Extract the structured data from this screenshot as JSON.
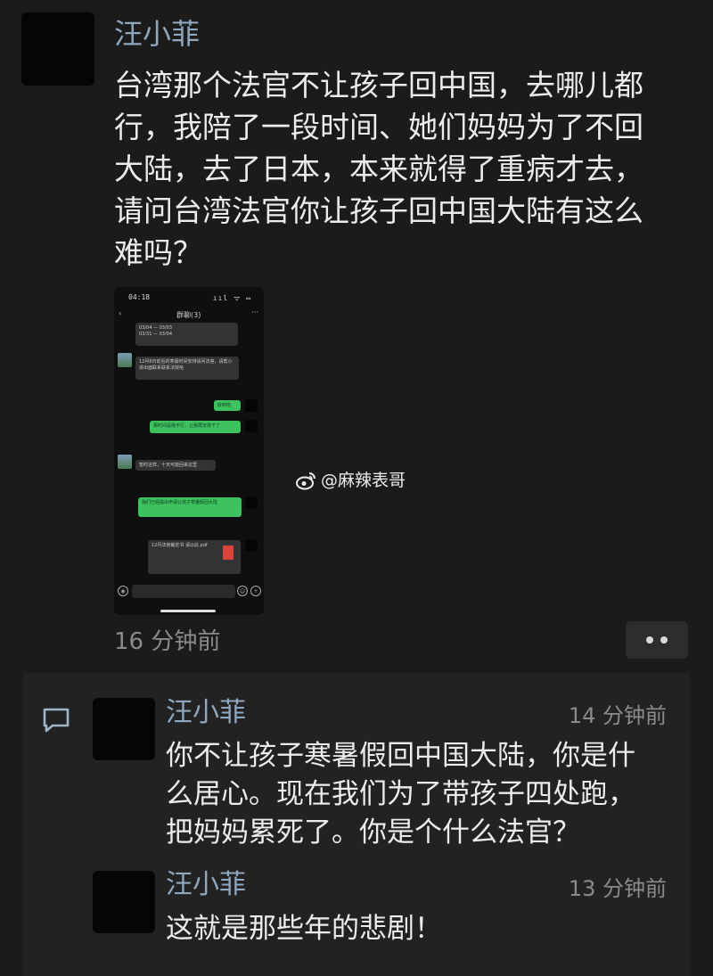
{
  "post": {
    "author": "汪小菲",
    "lines": [
      "台湾那个法官不让孩子回中国，去哪儿都",
      "行，我陪了一段时间、她们妈妈为了不回",
      "大陆，去了日本，本来就得了重病才去，",
      "请问台湾法官你让孩子回中国大陆有这么",
      "难吗？"
    ],
    "time": "16 分钟前"
  },
  "screenshot": {
    "clock": "04:18",
    "signal": "ııl ᯤ ▭",
    "title": "群聊(3)",
    "messages": [
      {
        "from": "other",
        "text": "03/04 — 03/03\n03/31 — 03/04"
      },
      {
        "from": "other",
        "text": "12月6日前后的寒假时间安排请问法官，请帮小孩出面联系联系法院哈"
      },
      {
        "from": "me",
        "text": "收到啦"
      },
      {
        "from": "me",
        "text": "那时间是我不行，让我再安排下了"
      },
      {
        "from": "other",
        "text": "暂时这样，十天可能回来这里"
      },
      {
        "from": "me",
        "text": "我们已经提出申请让孩子寒暑假回大陆"
      },
      {
        "from": "me",
        "text": "12月法官裁定书 请以此.pdf",
        "type": "file"
      }
    ]
  },
  "watermark": "@麻辣表哥",
  "replies": [
    {
      "author": "汪小菲",
      "time": "14 分钟前",
      "lines": [
        "你不让孩子寒暑假回中国大陆，你是什",
        "么居心。现在我们为了带孩子四处跑，",
        "把妈妈累死了。你是个什么法官？"
      ]
    },
    {
      "author": "汪小菲",
      "time": "13 分钟前",
      "lines": [
        "这就是那些年的悲剧！"
      ]
    }
  ],
  "colors": {
    "background": "#1b1b1b",
    "author": "#8fa7bf",
    "text": "#ececec",
    "muted": "#8b8b8b",
    "green_bubble": "#3ec25f"
  },
  "icons": {
    "more": "more-dots-icon",
    "comment": "comment-bubble-icon",
    "weibo": "weibo-logo-icon"
  }
}
